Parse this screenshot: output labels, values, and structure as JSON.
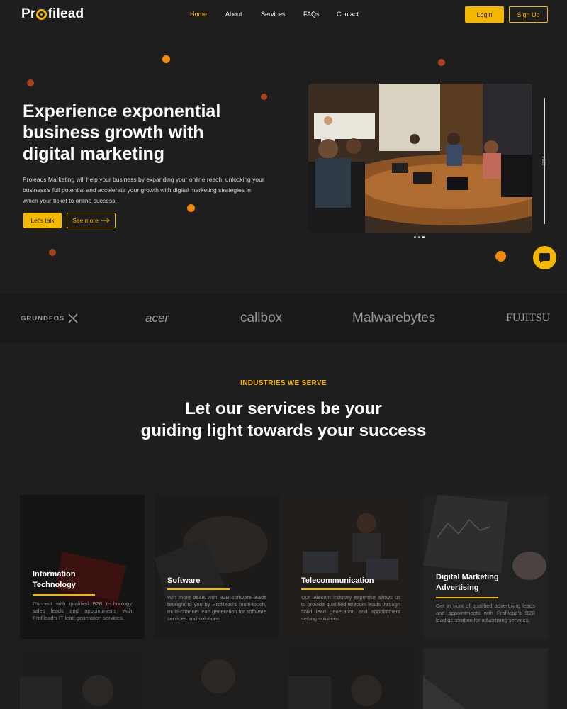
{
  "nav": {
    "logo": "Profilead",
    "links": [
      "Home",
      "About",
      "Services",
      "FAQs",
      "Contact"
    ],
    "login_label": "Login",
    "signup_label": "Sign Up"
  },
  "hero": {
    "title": "Experience exponential business growth with digital marketing",
    "description": "Proleads Marketing will help your business by expanding your online reach, unlocking your business's full potential and accelerate your growth with digital marketing strategies in which your ticket to online success.",
    "primary_cta": "Let's talk",
    "secondary_cta": "See more",
    "side_year": "2004",
    "slide_count": 3,
    "active_slide": 3
  },
  "clients": [
    "GRUNDFOS",
    "acer",
    "callbox",
    "Malwarebytes",
    "FUJITSU"
  ],
  "industries": {
    "eyebrow": "INDUSTRIES WE SERVE",
    "title_line1": "Let our services be your",
    "title_line2": "guiding light towards your success",
    "cards": [
      {
        "title": "Information Technology",
        "description": "Connect with qualified B2B technology sales leads and appointments with Profilead's IT lead generation services."
      },
      {
        "title": "Software",
        "description": "Win more deals with B2B software leads brought to you by Profilead's multi-touch, multi-channel lead generation for software services and solutions."
      },
      {
        "title": "Telecommunication",
        "description": "Our telecom industry expertise allows us to provide qualified telecom leads through solid lead generation and appointment setting solutions."
      },
      {
        "title": "Digital Marketing Advertising",
        "description": "Get in front of qualified advertising leads and appointments with Profilead's B2B lead generation for advertising services."
      }
    ]
  },
  "colors": {
    "accent": "#f5b800",
    "background": "#1f1e1e",
    "dot_orange": "#f28b0c",
    "dot_rust": "#a8441c"
  }
}
